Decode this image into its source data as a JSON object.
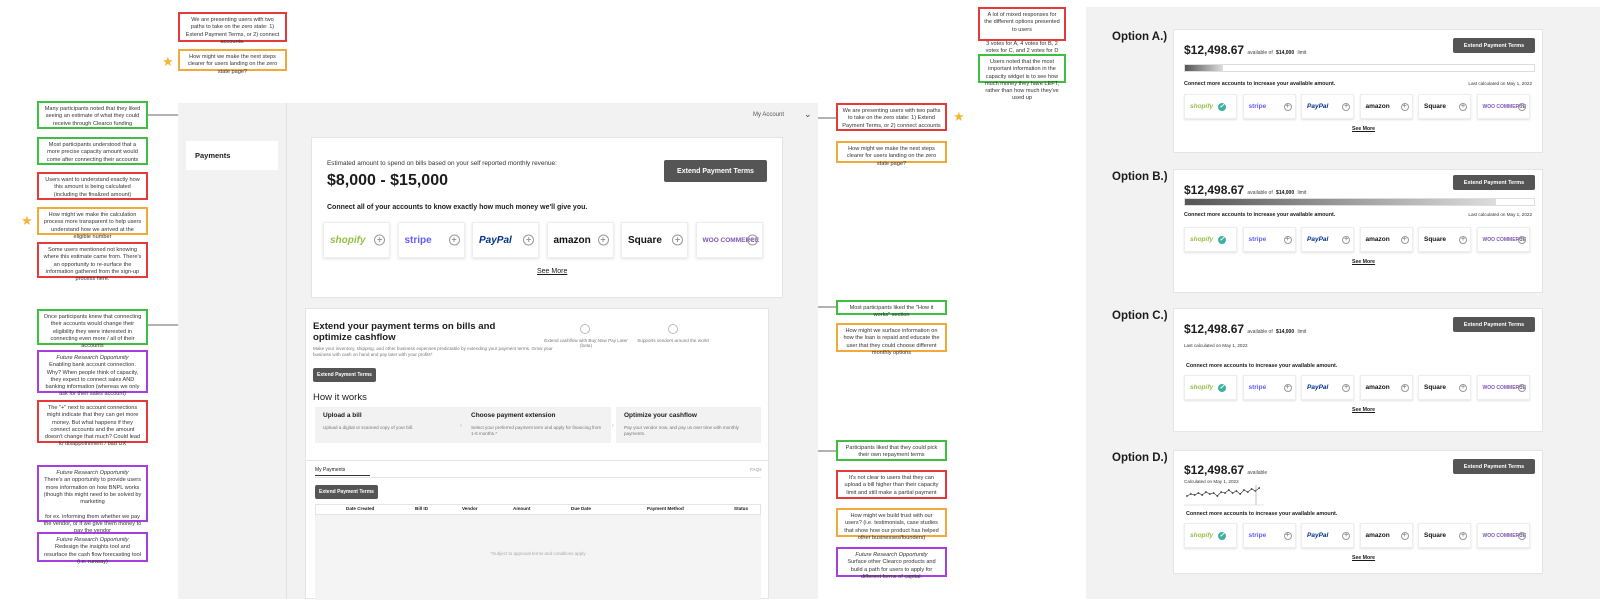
{
  "notes": {
    "top_red": "We are presenting users with two paths to take on the zero state: 1) Extend Payment Terms, or 2) connect accounts.",
    "top_orange": "How might we make the next steps clearer for users landing on the zero state page?",
    "left_green_1": "Many participants noted that they liked seeing an estimate of what they could receive through Clearco funding",
    "left_green_2": "Most participants understood that a more precise capacity amount would come after connecting their accounts",
    "left_red_1": "Users want to understand exactly how this amount is being calculated (including the finalized amount)",
    "left_orange_1": "How might we make the calculation process more transparent to help users understand how we arrived at the eligible number",
    "left_red_2": "Some users mentioned not knowing where this estimate came from. There's an opportunity to re-surface the information gathered from the sign-up process here.",
    "left_green_3": "Once participants knew that connecting their accounts would change their eligibility they were interested in connecting even more / all of their accounts",
    "left_purple_1_title": "Future Research Opportunity",
    "left_purple_1": "Enabling bank account connection. Why? When people think of capacity, they expect to connect sales AND banking information (whereas we only ask for their sales account)",
    "left_red_3": "The \"+\" next to account connections might indicate that they can get more money. But what happens if they connect accounts and the amount doesn't change that much? Could lead to disappointment / bad UX",
    "left_purple_2_title": "Future Research Opportunity",
    "left_purple_2a": "There's an opportunity to provide users more information on how BNPL works (though this might need to be solved by marketing",
    "left_purple_2b": "for ex. informing them whether we pay the vendor, or if we give them money to pay the vendor",
    "left_purple_3_title": "Future Research Opportunity",
    "left_purple_3": "Redesign the insights tool and resurface the cash flow forecasting tool (i.e. runway)",
    "right_red_1": "We are presenting users with two paths to take on the zero state: 1) Extend Payment Terms, or 2) connect accounts",
    "right_orange_1": "How might we make the next steps clearer for users landing on the zero state page?",
    "right_green_1": "Most participants liked the \"How it works\" section",
    "right_orange_2": "How might we surface information on how the loan is repaid and educate the user that they could choose different monthly options",
    "right_green_2": "Participants liked that they could pick their own repayment terms",
    "right_red_2": "It's not clear to users that they can upload a bill higher than their capacity limit and still make a partial payment",
    "right_orange_3": "How might we build trust with our users? (i.e. testimonials, case studies that show how our product has helped other businesses/founders)",
    "right_purple_title": "Future Research Opportunity",
    "right_purple": "Surface other Clearco products and build a path for users to apply for different forms of capital.",
    "mid_red_a": "A lot of mixed responses for the different options presented to users",
    "mid_red_b": "3 votes for A, 4 votes for B, 2 votes for C, and 2 votes for D",
    "mid_green": "Users noted that the most important information in the capacity widget is to see how much money they have LEFT, rather than how much they've used up"
  },
  "app": {
    "nav_payments": "Payments",
    "my_account": "My Account",
    "estimate_label": "Estimated amount to spend on bills based on your self reported monthly revenue:",
    "estimate_value": "$8,000 - $15,000",
    "extend_btn": "Extend Payment Terms",
    "connect_text": "Connect all of your accounts to know exactly how much money we'll give you.",
    "see_more": "See More",
    "extend_title": "Extend your payment terms on bills and optimize cashflow",
    "extend_desc": "Make your inventory, shipping, and other business expenses predictable by extending your payment terms. Grow your business with cash on hand and pay later with your profits*",
    "feature_1": "Extend cashflow with Buy Now Pay Later (beta)",
    "feature_2": "Supports vendors around the world",
    "extend_btn_small": "Extend Payment Terms",
    "how_title": "How it works",
    "steps": [
      {
        "title": "Upload a bill",
        "desc": "Upload a digital or scanned copy of your bill."
      },
      {
        "title": "Choose payment extension",
        "desc": "Select your preferred payment term and apply for financing from 1-6 months.*"
      },
      {
        "title": "Optimize your cashflow",
        "desc": "Pay your vendor now, and pay us over time with monthly payments."
      }
    ],
    "tab_my_payments": "My Payments",
    "faq": "FAQs",
    "table_btn": "Extend Payment Terms",
    "columns": [
      "Date Created",
      "Bill ID",
      "Vendor",
      "Amount",
      "Due Date",
      "Payment Method",
      "Status"
    ],
    "table_footnote": "*Subject to approval terms and conditions apply"
  },
  "logos": [
    "shopify",
    "stripe",
    "PayPal",
    "amazon",
    "Square",
    "WOO COMMERCE"
  ],
  "options": [
    {
      "label": "Option A.)",
      "amount": "$12,498.67",
      "available": "available of",
      "limit": "$14,000",
      "limit_suffix": "limit",
      "calc": "Last calculated on May 1, 2022",
      "connect": "Connect more accounts to increase your available amount.",
      "button": "Extend Payment Terms",
      "see_more": "See More",
      "bar_fill": 0.11
    },
    {
      "label": "Option B.)",
      "amount": "$12,498.67",
      "available": "available of",
      "limit": "$14,000",
      "limit_suffix": "limit",
      "calc": "Last calculated on May 1, 2022",
      "connect": "Connect more accounts to increase your available amount.",
      "button": "Extend Payment Terms",
      "see_more": "See More",
      "bar_fill": 0.89
    },
    {
      "label": "Option C.)",
      "amount": "$12,498.67",
      "available": "available of",
      "limit": "$14,000",
      "limit_suffix": "limit",
      "calc": "Last calculated on May 1, 2022",
      "connect": "Connect more accounts to increase your available amount.",
      "button": "Extend Payment Terms",
      "see_more": "See More"
    },
    {
      "label": "Option D.)",
      "amount": "$12,498.67",
      "available": "available",
      "calc": "Calculated on May 1, 2022",
      "connect": "Connect more accounts to increase your available amount.",
      "button": "Extend Payment Terms",
      "see_more": "See More"
    }
  ],
  "colors": {
    "button": "#555555",
    "shopify": "#95bf47",
    "stripe": "#635bff",
    "paypal": "#003087",
    "woo": "#7f54b3",
    "note_green": "#3fbf3f",
    "note_red": "#e53a3a",
    "note_orange": "#f2a93b",
    "note_purple": "#a63fe0"
  }
}
